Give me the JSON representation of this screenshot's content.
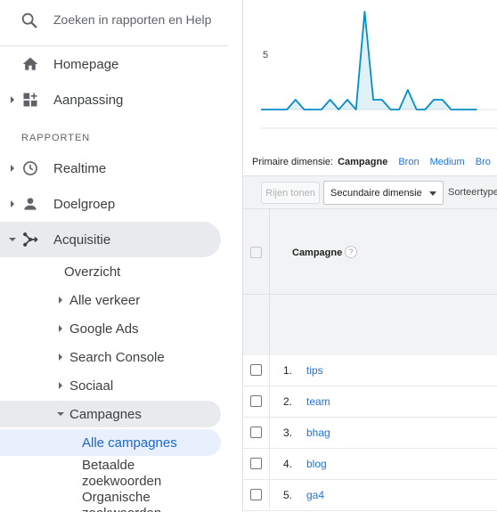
{
  "search": {
    "placeholder": "Zoeken in rapporten en Help"
  },
  "nav": {
    "homepage": "Homepage",
    "aanpassing": "Aanpassing",
    "section": "RAPPORTEN",
    "realtime": "Realtime",
    "doelgroep": "Doelgroep",
    "acquisitie": "Acquisitie"
  },
  "acquisitie_sub": {
    "overzicht": "Overzicht",
    "alle_verkeer": "Alle verkeer",
    "google_ads": "Google Ads",
    "search_console": "Search Console",
    "sociaal": "Sociaal",
    "campagnes": "Campagnes"
  },
  "campagnes_sub": {
    "alle_campagnes": "Alle campagnes",
    "betaalde_1": "Betaalde",
    "betaalde_2": "zoekwoorden",
    "organische_1": "Organische",
    "organische_2": "zoekwoorden"
  },
  "chart_data": {
    "type": "area",
    "ytick": "5",
    "values": [
      0,
      0,
      0,
      0,
      1,
      0,
      0,
      0,
      1,
      0,
      1,
      0,
      10,
      1,
      1,
      0,
      0,
      2,
      0,
      0,
      1,
      1,
      0,
      0,
      0,
      0
    ],
    "color": "#058dc7"
  },
  "dimension": {
    "label": "Primaire dimensie:",
    "current": "Campagne",
    "options": [
      "Bron",
      "Medium",
      "Bro"
    ]
  },
  "toolbar": {
    "show_rows": "Rijen tonen",
    "secondary_dimension": "Secundaire dimensie",
    "sort_type": "Sorteertype"
  },
  "table": {
    "column": "Campagne",
    "help": "?",
    "rows": [
      {
        "num": "1.",
        "name": "tips"
      },
      {
        "num": "2.",
        "name": "team"
      },
      {
        "num": "3.",
        "name": "bhag"
      },
      {
        "num": "4.",
        "name": "blog"
      },
      {
        "num": "5.",
        "name": "ga4"
      }
    ]
  }
}
